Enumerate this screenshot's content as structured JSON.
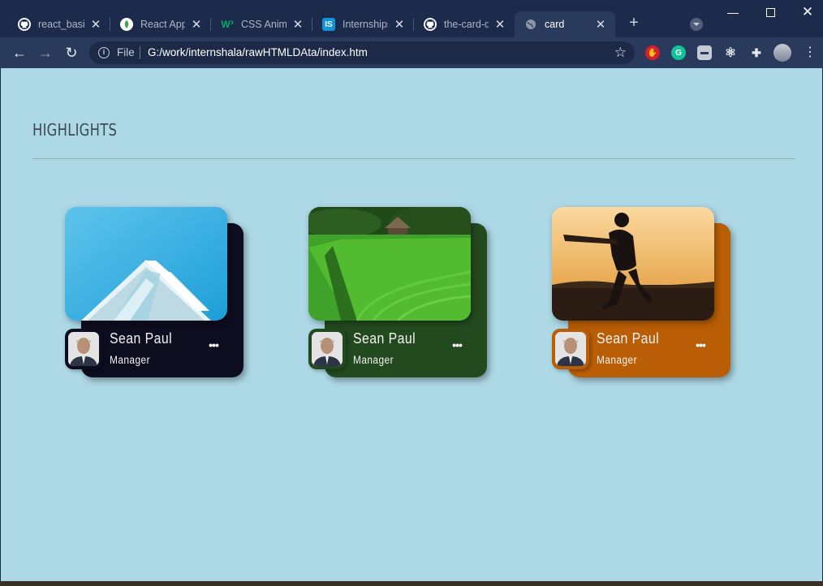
{
  "browser": {
    "tabs": [
      {
        "title": "react_basic",
        "icon": "github-icon",
        "active": false
      },
      {
        "title": "React App",
        "icon": "leaf-icon",
        "active": false
      },
      {
        "title": "CSS Animat",
        "icon": "w3schools-icon",
        "active": false
      },
      {
        "title": "Internships",
        "icon": "internshala-icon",
        "active": false
      },
      {
        "title": "the-card-d",
        "icon": "github-icon",
        "active": false
      },
      {
        "title": "card",
        "icon": "globe-icon",
        "active": true
      }
    ],
    "address": {
      "scheme_label": "File",
      "url": "G:/work/internshala/rawHTMLDAta/index.htm"
    },
    "extensions": [
      "adblock-icon",
      "grammarly-icon",
      "extension-icon",
      "react-devtools-icon",
      "puzzle-icon",
      "profile-avatar"
    ]
  },
  "page": {
    "heading": "HIGHLIGHTS",
    "background": "#add8e6",
    "cards": [
      {
        "name": "Sean Paul",
        "role": "Manager",
        "image": "building-photo",
        "accent": "#0e0d1f"
      },
      {
        "name": "Sean Paul",
        "role": "Manager",
        "image": "rice-field-photo",
        "accent": "#234a1f"
      },
      {
        "name": "Sean Paul",
        "role": "Manager",
        "image": "cricket-player-photo",
        "accent": "#b95e06"
      }
    ]
  }
}
